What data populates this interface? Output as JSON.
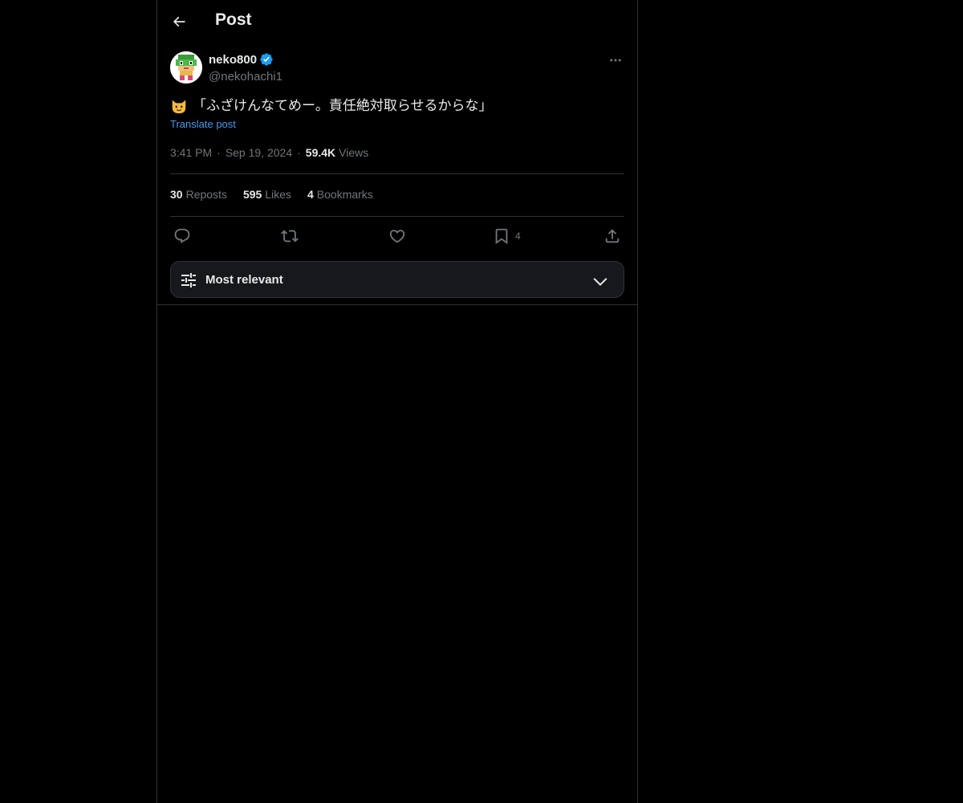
{
  "header": {
    "title": "Post",
    "back_icon": "arrow-left-icon"
  },
  "author": {
    "name": "neko800",
    "handle": "@nekohachi1",
    "verified_icon": "verified-badge-icon",
    "verified_color": "#1d9bf0"
  },
  "post": {
    "emoji_icon": "cat-face-emoji-icon",
    "text": "「ふざけんなてめー。責任絶対取らせるからな」",
    "translate_label": "Translate post",
    "time": "3:41 PM",
    "date": "Sep 19, 2024",
    "views_count": "59.4K",
    "views_label": "Views"
  },
  "stats": {
    "reposts_count": "30",
    "reposts_label": "Reposts",
    "likes_count": "595",
    "likes_label": "Likes",
    "bookmarks_count": "4",
    "bookmarks_label": "Bookmarks"
  },
  "actions": {
    "reply_icon": "reply-icon",
    "repost_icon": "repost-icon",
    "like_icon": "heart-icon",
    "bookmark_icon": "bookmark-icon",
    "bookmark_count": "4",
    "share_icon": "share-icon"
  },
  "sort": {
    "label": "Most relevant",
    "icon": "sliders-icon",
    "chevron": "chevron-down-icon"
  },
  "colors": {
    "background": "#000000",
    "text": "#e7e9ea",
    "muted": "#71767b",
    "link": "#1d9bf0",
    "border": "#2f3336"
  }
}
